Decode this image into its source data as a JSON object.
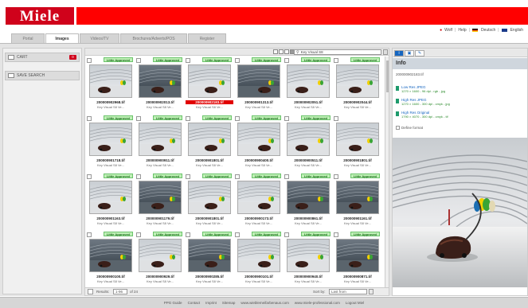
{
  "brand": {
    "logo": "Miele",
    "color": "#d0021b"
  },
  "user_links": {
    "user": "Wolf",
    "help": "Help",
    "lang_de": "Deutsch",
    "lang_en": "English"
  },
  "tabs": [
    {
      "label": "Portal",
      "active": false
    },
    {
      "label": "Images",
      "active": true
    },
    {
      "label": "Videos/TV",
      "active": false
    },
    {
      "label": "Brochures/Adverts/POS",
      "active": false
    },
    {
      "label": "Register",
      "active": false
    }
  ],
  "sidebar": {
    "cart_label": "CART",
    "cart_count": "0",
    "search_label": "SAVE SEARCH"
  },
  "search": {
    "value": "Key Visual S8",
    "placeholder": "Search"
  },
  "grid": {
    "rows": [
      [
        {
          "badge": "Little Approved",
          "name": "200000902968.tif",
          "desc": "Key Visual S8 Ve...",
          "selected": false,
          "dark": false
        },
        {
          "badge": "Little Approved",
          "name": "200000902013.tif",
          "desc": "Key Visual S8 Ve...",
          "selected": false,
          "dark": true
        },
        {
          "badge": "Little Approved",
          "name": "200000902183.tif",
          "desc": "Key Visual S8 Ve...",
          "selected": true,
          "dark": false
        },
        {
          "badge": "Little Approved",
          "name": "200000901313.tif",
          "desc": "Key Visual S8 Ve...",
          "selected": false,
          "dark": true
        },
        {
          "badge": "Little Approved",
          "name": "200000902051.tif",
          "desc": "Key Visual S8 Ve...",
          "selected": false,
          "dark": false
        },
        {
          "badge": "Little Approved",
          "name": "200000902044.tif",
          "desc": "Key Visual S8 Ve...",
          "selected": false,
          "dark": false
        }
      ],
      [
        {
          "badge": "Little Approved",
          "name": "200000901718.tif",
          "desc": "Key Visual S8 Ve...",
          "selected": false,
          "dark": false
        },
        {
          "badge": "Little Approved",
          "name": "200000900911.tif",
          "desc": "Key Visual S8 Ve...",
          "selected": false,
          "dark": false
        },
        {
          "badge": "Little Approved",
          "name": "200000901801.tif",
          "desc": "Key Visual S8 Ve...",
          "selected": false,
          "dark": false
        },
        {
          "badge": "Little Approved",
          "name": "200000900400.tif",
          "desc": "Key Visual S8 Ve...",
          "selected": false,
          "dark": false
        },
        {
          "badge": "Little Approved",
          "name": "200000900511.tif",
          "desc": "Key Visual S8 Ve...",
          "selected": false,
          "dark": false
        },
        {
          "badge": "",
          "name": "200000901801.tif",
          "desc": "Key Visual S8 Ve...",
          "selected": false,
          "dark": false
        }
      ],
      [
        {
          "badge": "Little Approved",
          "name": "200000901163.tif",
          "desc": "Key Visual S8 Ve...",
          "selected": false,
          "dark": false
        },
        {
          "badge": "Little Approved",
          "name": "200000901179.tif",
          "desc": "Key Visual S8 Ve...",
          "selected": false,
          "dark": true
        },
        {
          "badge": "Little Approved",
          "name": "200000901801.tif",
          "desc": "Key Visual S8 Ve...",
          "selected": false,
          "dark": false
        },
        {
          "badge": "Little Approved",
          "name": "200000900173.tif",
          "desc": "Key Visual S8 Ve...",
          "selected": false,
          "dark": false
        },
        {
          "badge": "Little Approved",
          "name": "200000900861.tif",
          "desc": "Key Visual S8 Ve...",
          "selected": false,
          "dark": true
        },
        {
          "badge": "Little Approved",
          "name": "200000901161.tif",
          "desc": "Key Visual S8 Ve...",
          "selected": false,
          "dark": true
        }
      ],
      [
        {
          "badge": "Little Approved",
          "name": "200000900100.tif",
          "desc": "Key Visual S8 Ve...",
          "selected": false,
          "dark": true
        },
        {
          "badge": "Little Approved",
          "name": "200000900929.tif",
          "desc": "Key Visual S8 Ve...",
          "selected": false,
          "dark": false
        },
        {
          "badge": "Little Approved",
          "name": "200000900285.tif",
          "desc": "Key Visual S8 Ve...",
          "selected": false,
          "dark": true
        },
        {
          "badge": "Little Approved",
          "name": "200000900101.tif",
          "desc": "Key Visual S8 Ve...",
          "selected": false,
          "dark": false
        },
        {
          "badge": "Little Approved",
          "name": "200000900940.tif",
          "desc": "Key Visual S8 Ve...",
          "selected": false,
          "dark": false
        },
        {
          "badge": "Little Approved",
          "name": "200000900871.tif",
          "desc": "Key Visual S8 Ve...",
          "selected": false,
          "dark": true
        }
      ]
    ]
  },
  "pager": {
    "results_label": "Results:",
    "per_page": "1-96",
    "of_label": "of 24",
    "sort_label": "Sort by:",
    "sort_value": "Last from"
  },
  "info": {
    "title": "Info",
    "filename": "200000902183.tif",
    "downloads": [
      {
        "title": "Low Res JPEG",
        "meta": "1270 × 1600 - 96 dpi - rgb - jpg"
      },
      {
        "title": "High Res JPEG",
        "meta": "1270 × 1600 - 300 dpi - cmyk - jpg"
      },
      {
        "title": "High Res Original",
        "meta": "1790 × 4070 - 300 dpi - cmyk - tif"
      }
    ],
    "define_label": "Define format"
  },
  "footer_links": [
    "PPG Guide",
    "Contact",
    "Imprint",
    "Sitemap",
    "www.wieblemeifarbenaus.com",
    "www.miele-professional.com",
    "Logout Miel"
  ]
}
